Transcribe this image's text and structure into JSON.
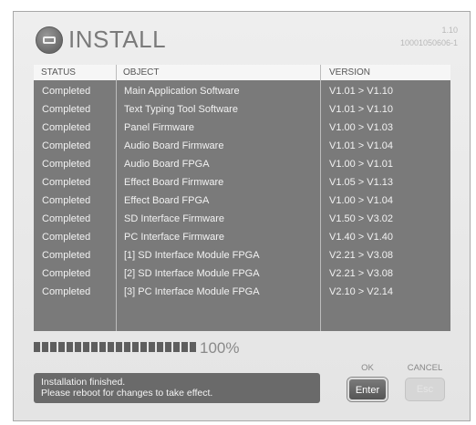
{
  "header": {
    "title": "INSTALL",
    "version": "1.10",
    "build": "10001050606-1",
    "icon": "device-icon"
  },
  "table": {
    "columns": [
      "STATUS",
      "OBJECT",
      "VERSION"
    ],
    "rows": [
      {
        "status": "Completed",
        "object": "Main Application Software",
        "version": "V1.01 > V1.10"
      },
      {
        "status": "Completed",
        "object": "Text Typing Tool Software",
        "version": "V1.01 > V1.10"
      },
      {
        "status": "Completed",
        "object": "Panel  Firmware",
        "version": "V1.00 > V1.03"
      },
      {
        "status": "Completed",
        "object": "Audio  Board Firmware",
        "version": "V1.01 > V1.04"
      },
      {
        "status": "Completed",
        "object": "Audio  Board FPGA",
        "version": "V1.00 > V1.01"
      },
      {
        "status": "Completed",
        "object": "Effect  Board Firmware",
        "version": "V1.05 > V1.13"
      },
      {
        "status": "Completed",
        "object": "Effect  Board FPGA",
        "version": "V1.00 > V1.04"
      },
      {
        "status": "Completed",
        "object": "SD Interface  Firmware",
        "version": "V1.50 > V3.02"
      },
      {
        "status": "Completed",
        "object": "PC Interface  Firmware",
        "version": "V1.40 > V1.40"
      },
      {
        "status": "Completed",
        "object": "[1] SD Interface Module FPGA",
        "version": "V2.21 > V3.08"
      },
      {
        "status": "Completed",
        "object": "[2] SD Interface Module FPGA",
        "version": "V2.21 > V3.08"
      },
      {
        "status": "Completed",
        "object": "[3] PC Interface Module FPGA",
        "version": "V2.10 > V2.14"
      }
    ]
  },
  "progress": {
    "percent_text": "100%",
    "fraction": 1.0
  },
  "status_message": {
    "line1": "Installation finished.",
    "line2": "Please reboot for changes to take effect."
  },
  "buttons": {
    "ok_label": "OK",
    "ok_key": "Enter",
    "cancel_label": "CANCEL",
    "cancel_key": "Esc"
  },
  "colors": {
    "panel": "#e8e8e8",
    "table_bg": "#7a7a7a",
    "status_bg": "#6a6a6a"
  }
}
